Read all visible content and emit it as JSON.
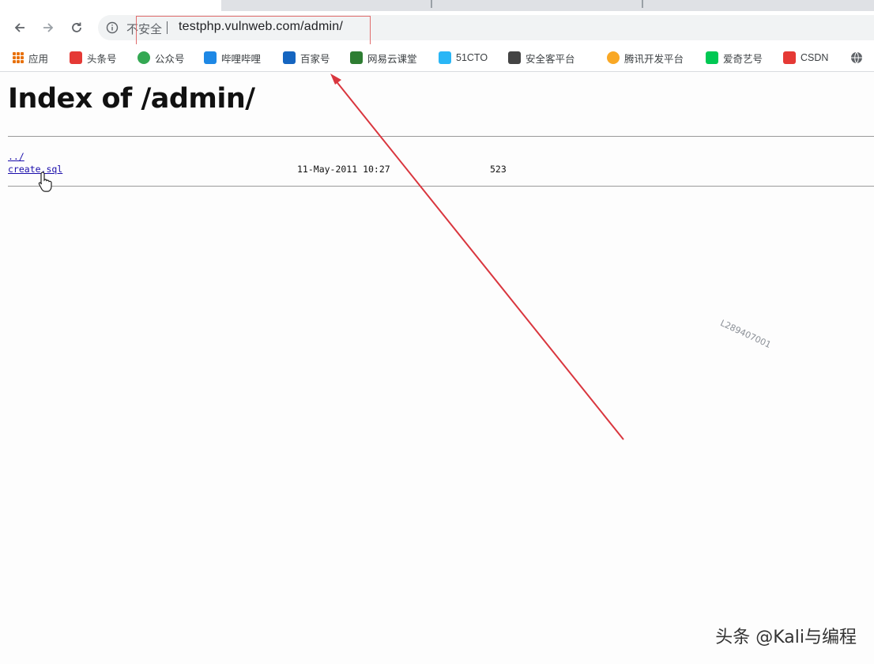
{
  "browser": {
    "security_label": "不安全",
    "url": "testphp.vulnweb.com/admin/"
  },
  "bookmarks": [
    {
      "label": "应用",
      "icon": "apps-grid-icon",
      "color": "#e8710a"
    },
    {
      "label": "头条号",
      "icon": "toutiao-icon",
      "color": "#e53935"
    },
    {
      "label": "公众号",
      "icon": "wechat-mp-icon",
      "color": "#34a853"
    },
    {
      "label": "哔哩哔哩",
      "icon": "bilibili-icon",
      "color": "#1e88e5"
    },
    {
      "label": "百家号",
      "icon": "baijia-icon",
      "color": "#1565c0"
    },
    {
      "label": "网易云课堂",
      "icon": "netease-classroom-icon",
      "color": "#2e7d32"
    },
    {
      "label": "51CTO",
      "icon": "51cto-icon",
      "color": "#29b6f6"
    },
    {
      "label": "安全客平台",
      "icon": "anquanke-icon",
      "color": "#444444"
    },
    {
      "label": "腾讯开发平台",
      "icon": "tencent-dev-icon",
      "color": "#f9a825"
    },
    {
      "label": "爱奇艺号",
      "icon": "iqiyi-icon",
      "color": "#00c853"
    },
    {
      "label": "CSDN",
      "icon": "csdn-icon",
      "color": "#e53935"
    },
    {
      "label": "",
      "icon": "globe-icon",
      "color": "#5f6368"
    }
  ],
  "page": {
    "heading": "Index of /admin/",
    "entries": [
      {
        "name": "../",
        "date": "",
        "size": ""
      },
      {
        "name": "create.sql",
        "date": "11-May-2011 10:27",
        "size": "523"
      }
    ]
  },
  "watermark_code": "L289407001",
  "brand_watermark": "头条 @Kali与编程",
  "colors": {
    "annotation_red": "#d9363e",
    "link": "#1a0dab"
  }
}
